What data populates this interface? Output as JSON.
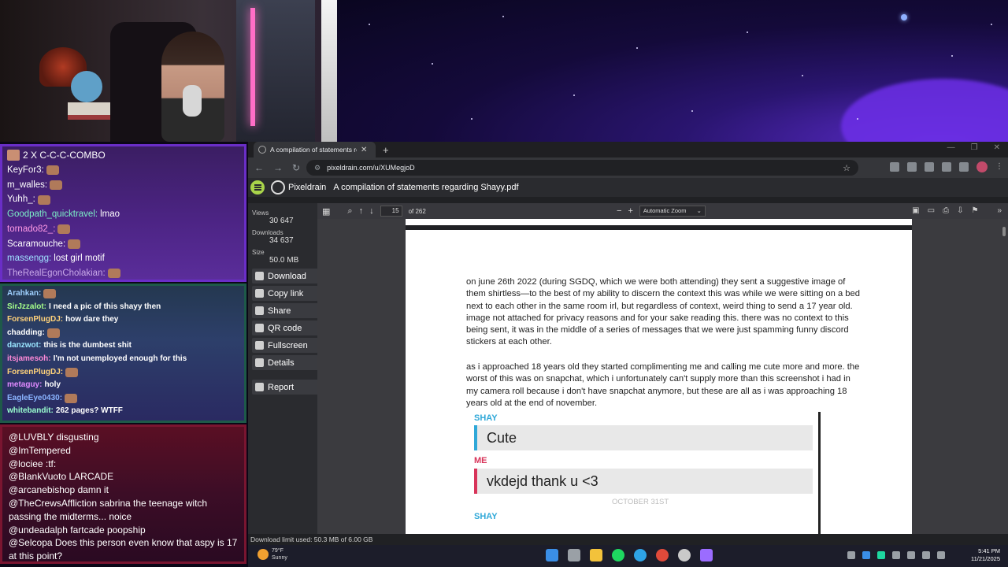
{
  "chat_top": {
    "combo_text": "2 X C-C-C-COMBO",
    "messages": [
      {
        "user": "KeyFor3:",
        "text": "",
        "color": "#ffffff"
      },
      {
        "user": "m_walles:",
        "text": "",
        "color": "#ffffff"
      },
      {
        "user": "Yuhh_:",
        "text": "",
        "color": "#ffffff"
      },
      {
        "user": "Goodpath_quicktravel:",
        "text": "lmao",
        "color": "#7cf0c8"
      },
      {
        "user": "tornado82_:",
        "text": "",
        "color": "#ff9ae6"
      },
      {
        "user": "Scaramouche:",
        "text": "",
        "color": "#ffffff"
      },
      {
        "user": "massengg:",
        "text": "lost girl motif",
        "color": "#9fe0ff"
      },
      {
        "user": "TheRealEgonCholakian:",
        "text": "",
        "color": "#c8a8e8"
      }
    ]
  },
  "chat_mid": {
    "messages": [
      {
        "user": "Arahkan:",
        "text": "",
        "color": "#9fd0ff"
      },
      {
        "user": "SirJzzalot:",
        "text": "I need a pic of this shayy then",
        "color": "#a6ff8a"
      },
      {
        "user": "ForsenPlugDJ:",
        "text": "how dare they",
        "color": "#ffd27a"
      },
      {
        "user": "chadding:",
        "text": "",
        "color": "#ffffff"
      },
      {
        "user": "danzwot:",
        "text": "this is the dumbest shit",
        "color": "#9ae6ff"
      },
      {
        "user": "itsjamesoh:",
        "text": "I'm not unemployed enough for this",
        "color": "#ff8ad8"
      },
      {
        "user": "ForsenPlugDJ:",
        "text": "",
        "color": "#ffd27a"
      },
      {
        "user": "metaguy:",
        "text": "holy",
        "color": "#e08aff"
      },
      {
        "user": "EagleEye0430:",
        "text": "",
        "color": "#8ab4ff"
      },
      {
        "user": "whitebandit:",
        "text": "262 pages? WTFF",
        "color": "#9affd0"
      }
    ]
  },
  "chat_bottom": {
    "messages": [
      {
        "user": "@LUVBLY",
        "text": "disgusting"
      },
      {
        "user": "@ImTempered",
        "text": ""
      },
      {
        "user": "@lociee",
        "text": ":tf:"
      },
      {
        "user": "@BlankVuoto",
        "text": "LARCADE"
      },
      {
        "user": "@arcanebishop",
        "text": "damn it"
      },
      {
        "user": "@TheCrewsAffliction",
        "text": "sabrina the teenage witch passing the midterms... noice"
      },
      {
        "user": "@undeadalph",
        "text": "fartcade poopship"
      },
      {
        "user": "@Selcopa",
        "text": "Does this person even know that aspy is 17 at this point?"
      }
    ]
  },
  "browser": {
    "tab_title": "A compilation of statements rega",
    "url": "pixeldrain.com/u/XUMegjoD",
    "window_controls": [
      "—",
      "❐",
      "✕"
    ]
  },
  "pixeldrain": {
    "brand": "Pixeldrain",
    "file_name": "A compilation of statements regarding Shayy.pdf",
    "stats": {
      "views_label": "Views",
      "views": "30 647",
      "downloads_label": "Downloads",
      "downloads": "34 637",
      "size_label": "Size",
      "size": "50.0 MB"
    },
    "buttons": [
      "Download",
      "Copy link",
      "Share",
      "QR code",
      "Fullscreen",
      "Details",
      "Report"
    ],
    "download_limit": "Download limit used: 50.3 MB of 6.00 GB"
  },
  "pdf_viewer": {
    "page_number": "15",
    "of_pages": "of 262",
    "zoom": "Automatic Zoom",
    "paragraph1": "on june 26th 2022 (during SGDQ, which we were both attending) they sent a suggestive image of them shirtless—to the best of my ability to discern the context this was while we were sitting on a bed next to each other in the same room irl, but regardless of context, weird thing to send a 17 year old. image not attached for privacy reasons and for your sake reading this. there was no context to this being sent, it was in the middle of a series of messages that we were just spamming funny discord stickers at each other.",
    "paragraph2": "as i approached 18 years old they started complimenting me and calling me cute more and more. the worst of this was on snapchat, which i unfortunately can't supply more than this screenshot i had in my camera roll because i don't have snapchat anymore, but these are all as i was approaching 18 years old at the end of november.",
    "screenshot": {
      "sender1": "SHAY",
      "msg1": "Cute",
      "sender2": "ME",
      "msg2": "vkdejd thank u <3",
      "date": "OCTOBER 31ST",
      "sender3": "SHAY"
    },
    "colors": {
      "shay": "#2fa8d8",
      "me": "#d8345a"
    }
  },
  "taskbar": {
    "temperature": "79°F",
    "condition": "Sunny",
    "time": "5:41 PM",
    "date": "11/21/2025"
  }
}
